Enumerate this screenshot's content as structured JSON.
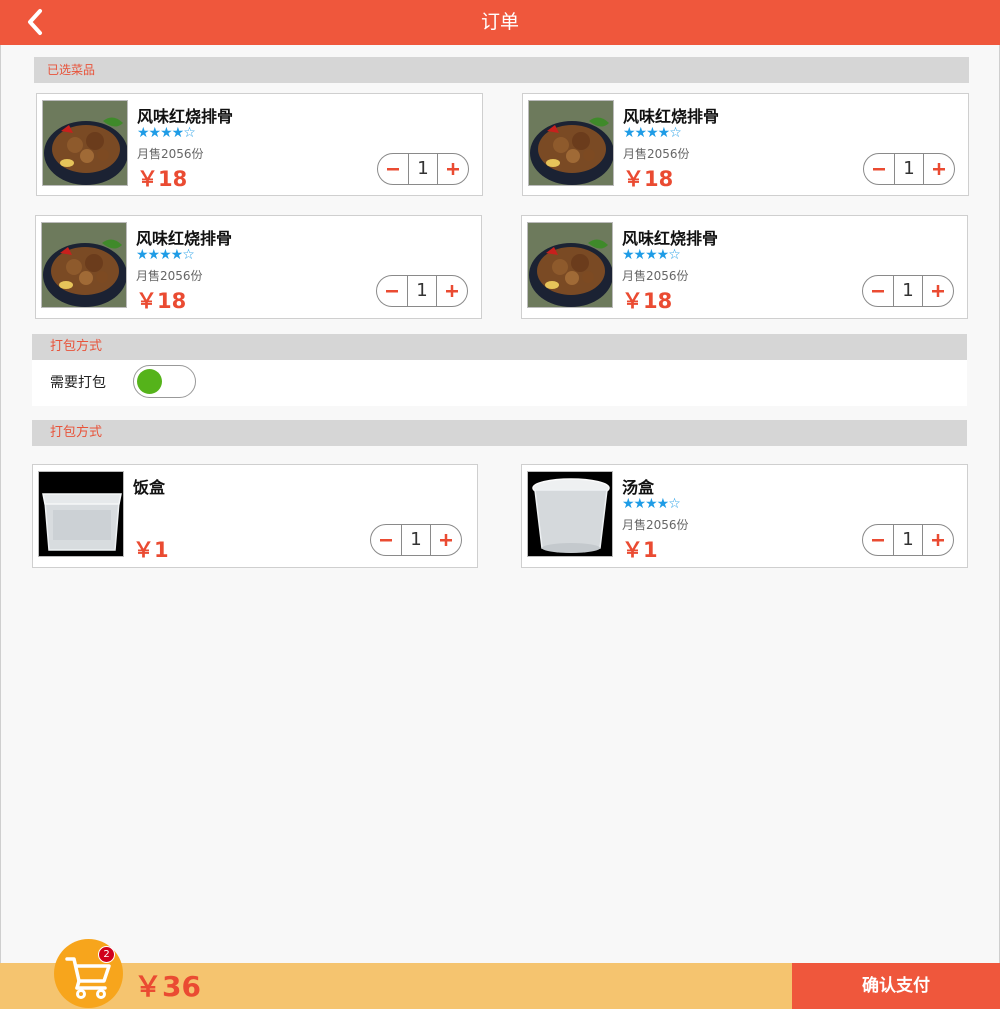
{
  "header": {
    "title": "订单"
  },
  "sections": {
    "selected_dishes": "已选菜品",
    "packaging_method": "打包方式",
    "packaging_method_2": "打包方式"
  },
  "packaging": {
    "label": "需要打包",
    "enabled": true
  },
  "dishes": [
    {
      "name": "风味红烧排骨",
      "rating": 4,
      "stars": "★★★★☆",
      "sales": "月售2056份",
      "price": "￥18",
      "qty": "1"
    },
    {
      "name": "风味红烧排骨",
      "rating": 4,
      "stars": "★★★★☆",
      "sales": "月售2056份",
      "price": "￥18",
      "qty": "1"
    },
    {
      "name": "风味红烧排骨",
      "rating": 4,
      "stars": "★★★★☆",
      "sales": "月售2056份",
      "price": "￥18",
      "qty": "1"
    },
    {
      "name": "风味红烧排骨",
      "rating": 4,
      "stars": "★★★★☆",
      "sales": "月售2056份",
      "price": "￥18",
      "qty": "1"
    }
  ],
  "containers": [
    {
      "name": "饭盒",
      "price": "￥1",
      "qty": "1"
    },
    {
      "name": "汤盒",
      "rating": 4,
      "stars": "★★★★☆",
      "sales": "月售2056份",
      "price": "￥1",
      "qty": "1"
    }
  ],
  "footer": {
    "cart_count": "2",
    "total": "￥36",
    "pay_label": "确认支付"
  },
  "colors": {
    "header": "#ef573c",
    "price": "#ea4b32",
    "star": "#1f9ce6",
    "toggle_on": "#55b31a",
    "footer_bar": "#f5c46f",
    "cart": "#f7a51c"
  }
}
